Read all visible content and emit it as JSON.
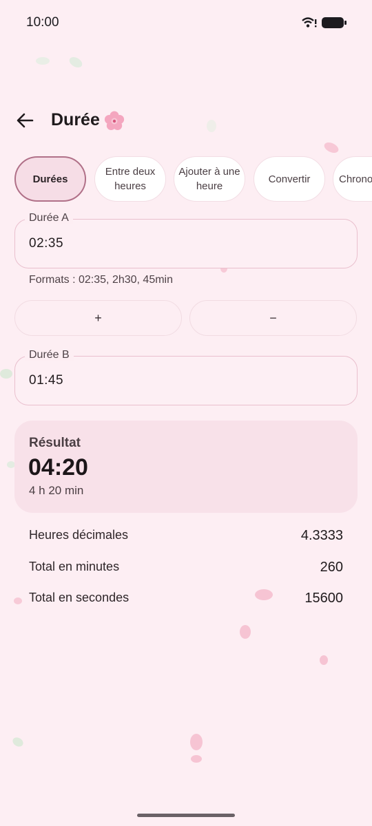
{
  "status_bar": {
    "time": "10:00"
  },
  "header": {
    "title": "Durée"
  },
  "tabs": [
    {
      "label": "Durées",
      "active": true
    },
    {
      "label": "Entre deux heures",
      "active": false
    },
    {
      "label": "Ajouter à une heure",
      "active": false
    },
    {
      "label": "Convertir",
      "active": false
    },
    {
      "label": "Chrono",
      "active": false
    }
  ],
  "duration_a": {
    "label": "Durée A",
    "value": "02:35"
  },
  "helper": "Formats : 02:35, 2h30, 45min",
  "operations": {
    "add": "+",
    "subtract": "−"
  },
  "duration_b": {
    "label": "Durée B",
    "value": "01:45"
  },
  "result": {
    "title": "Résultat",
    "value": "04:20",
    "subtitle": "4 h 20 min"
  },
  "stats": [
    {
      "label": "Heures décimales",
      "value": "4.3333"
    },
    {
      "label": "Total en minutes",
      "value": "260"
    },
    {
      "label": "Total en secondes",
      "value": "15600"
    }
  ],
  "colors": {
    "background": "#fdeef3",
    "accent": "#b07088",
    "card": "#f8e1e9"
  }
}
